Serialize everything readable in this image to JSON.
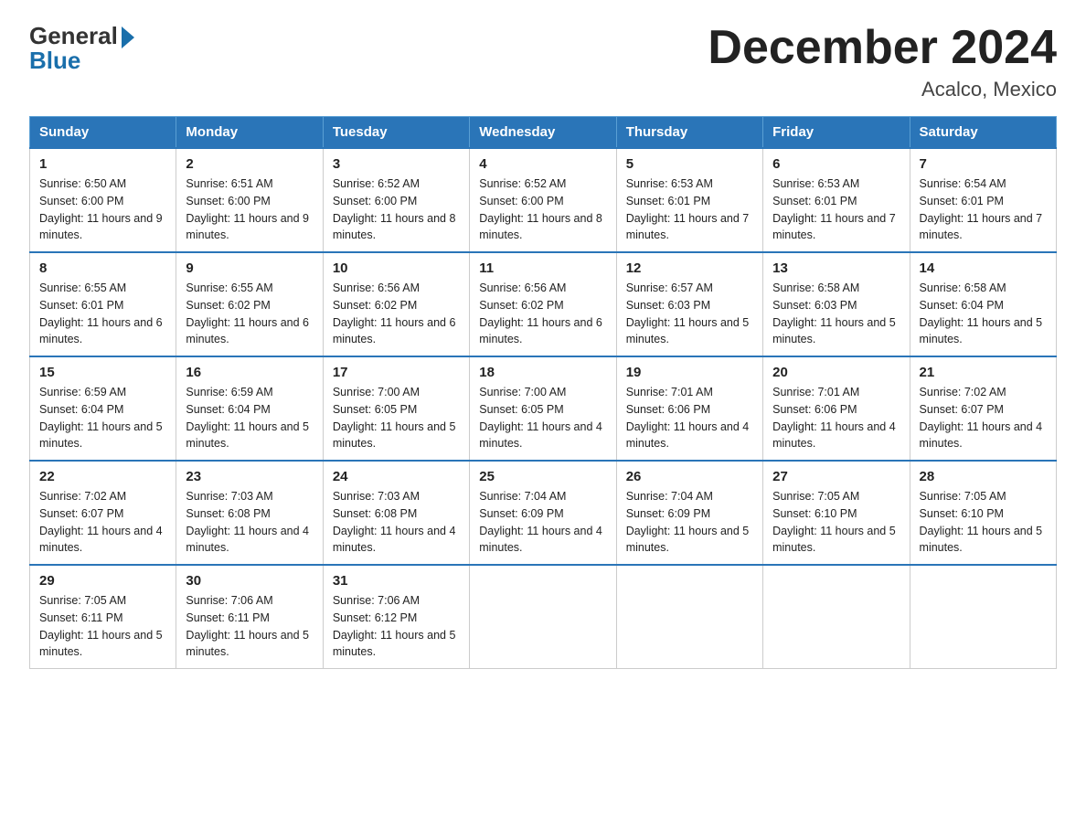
{
  "logo": {
    "general": "General",
    "blue": "Blue"
  },
  "title": "December 2024",
  "subtitle": "Acalco, Mexico",
  "weekdays": [
    "Sunday",
    "Monday",
    "Tuesday",
    "Wednesday",
    "Thursday",
    "Friday",
    "Saturday"
  ],
  "weeks": [
    [
      {
        "day": "1",
        "sunrise": "6:50 AM",
        "sunset": "6:00 PM",
        "daylight": "11 hours and 9 minutes."
      },
      {
        "day": "2",
        "sunrise": "6:51 AM",
        "sunset": "6:00 PM",
        "daylight": "11 hours and 9 minutes."
      },
      {
        "day": "3",
        "sunrise": "6:52 AM",
        "sunset": "6:00 PM",
        "daylight": "11 hours and 8 minutes."
      },
      {
        "day": "4",
        "sunrise": "6:52 AM",
        "sunset": "6:00 PM",
        "daylight": "11 hours and 8 minutes."
      },
      {
        "day": "5",
        "sunrise": "6:53 AM",
        "sunset": "6:01 PM",
        "daylight": "11 hours and 7 minutes."
      },
      {
        "day": "6",
        "sunrise": "6:53 AM",
        "sunset": "6:01 PM",
        "daylight": "11 hours and 7 minutes."
      },
      {
        "day": "7",
        "sunrise": "6:54 AM",
        "sunset": "6:01 PM",
        "daylight": "11 hours and 7 minutes."
      }
    ],
    [
      {
        "day": "8",
        "sunrise": "6:55 AM",
        "sunset": "6:01 PM",
        "daylight": "11 hours and 6 minutes."
      },
      {
        "day": "9",
        "sunrise": "6:55 AM",
        "sunset": "6:02 PM",
        "daylight": "11 hours and 6 minutes."
      },
      {
        "day": "10",
        "sunrise": "6:56 AM",
        "sunset": "6:02 PM",
        "daylight": "11 hours and 6 minutes."
      },
      {
        "day": "11",
        "sunrise": "6:56 AM",
        "sunset": "6:02 PM",
        "daylight": "11 hours and 6 minutes."
      },
      {
        "day": "12",
        "sunrise": "6:57 AM",
        "sunset": "6:03 PM",
        "daylight": "11 hours and 5 minutes."
      },
      {
        "day": "13",
        "sunrise": "6:58 AM",
        "sunset": "6:03 PM",
        "daylight": "11 hours and 5 minutes."
      },
      {
        "day": "14",
        "sunrise": "6:58 AM",
        "sunset": "6:04 PM",
        "daylight": "11 hours and 5 minutes."
      }
    ],
    [
      {
        "day": "15",
        "sunrise": "6:59 AM",
        "sunset": "6:04 PM",
        "daylight": "11 hours and 5 minutes."
      },
      {
        "day": "16",
        "sunrise": "6:59 AM",
        "sunset": "6:04 PM",
        "daylight": "11 hours and 5 minutes."
      },
      {
        "day": "17",
        "sunrise": "7:00 AM",
        "sunset": "6:05 PM",
        "daylight": "11 hours and 5 minutes."
      },
      {
        "day": "18",
        "sunrise": "7:00 AM",
        "sunset": "6:05 PM",
        "daylight": "11 hours and 4 minutes."
      },
      {
        "day": "19",
        "sunrise": "7:01 AM",
        "sunset": "6:06 PM",
        "daylight": "11 hours and 4 minutes."
      },
      {
        "day": "20",
        "sunrise": "7:01 AM",
        "sunset": "6:06 PM",
        "daylight": "11 hours and 4 minutes."
      },
      {
        "day": "21",
        "sunrise": "7:02 AM",
        "sunset": "6:07 PM",
        "daylight": "11 hours and 4 minutes."
      }
    ],
    [
      {
        "day": "22",
        "sunrise": "7:02 AM",
        "sunset": "6:07 PM",
        "daylight": "11 hours and 4 minutes."
      },
      {
        "day": "23",
        "sunrise": "7:03 AM",
        "sunset": "6:08 PM",
        "daylight": "11 hours and 4 minutes."
      },
      {
        "day": "24",
        "sunrise": "7:03 AM",
        "sunset": "6:08 PM",
        "daylight": "11 hours and 4 minutes."
      },
      {
        "day": "25",
        "sunrise": "7:04 AM",
        "sunset": "6:09 PM",
        "daylight": "11 hours and 4 minutes."
      },
      {
        "day": "26",
        "sunrise": "7:04 AM",
        "sunset": "6:09 PM",
        "daylight": "11 hours and 5 minutes."
      },
      {
        "day": "27",
        "sunrise": "7:05 AM",
        "sunset": "6:10 PM",
        "daylight": "11 hours and 5 minutes."
      },
      {
        "day": "28",
        "sunrise": "7:05 AM",
        "sunset": "6:10 PM",
        "daylight": "11 hours and 5 minutes."
      }
    ],
    [
      {
        "day": "29",
        "sunrise": "7:05 AM",
        "sunset": "6:11 PM",
        "daylight": "11 hours and 5 minutes."
      },
      {
        "day": "30",
        "sunrise": "7:06 AM",
        "sunset": "6:11 PM",
        "daylight": "11 hours and 5 minutes."
      },
      {
        "day": "31",
        "sunrise": "7:06 AM",
        "sunset": "6:12 PM",
        "daylight": "11 hours and 5 minutes."
      },
      null,
      null,
      null,
      null
    ]
  ]
}
